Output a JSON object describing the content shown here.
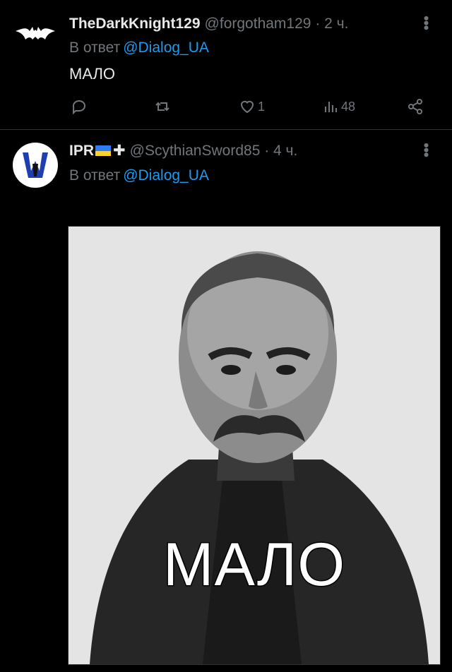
{
  "tweets": [
    {
      "name": "TheDarkKnight129",
      "handle": "@forgotham129",
      "time": "· 2 ч.",
      "reply_prefix": "В ответ",
      "reply_to": "@Dialog_UA",
      "text": "МАЛО",
      "avatar_icon": "batman-bat-logo",
      "stats": {
        "replies": "",
        "retweets": "",
        "likes": "1",
        "views": "48"
      }
    },
    {
      "name": "IPR",
      "name_suffix_icons": [
        "ukraine-flag",
        "cross"
      ],
      "handle": "@ScythianSword85",
      "time": "· 4 ч.",
      "reply_prefix": "В ответ",
      "reply_to": "@Dialog_UA",
      "avatar_icon": "trident-emblem",
      "media": {
        "caption": "МАЛО"
      }
    }
  ],
  "colors": {
    "background": "#000000",
    "link": "#1d9bf0",
    "muted": "#71767b",
    "text": "#e7e9ea"
  }
}
